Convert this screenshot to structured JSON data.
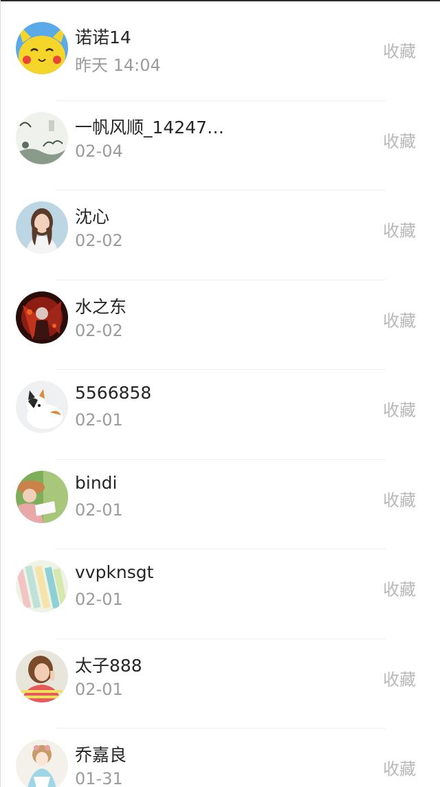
{
  "favorites_list": {
    "items": [
      {
        "name": "诺诺14",
        "time": "昨天 14:04",
        "action": "收藏",
        "avatar_icon": "pikachu-avatar-icon"
      },
      {
        "name": "一帆风顺_14247…",
        "time": "02-04",
        "action": "收藏",
        "avatar_icon": "ink-landscape-avatar-icon"
      },
      {
        "name": "沈心",
        "time": "02-02",
        "action": "收藏",
        "avatar_icon": "woman-portrait-avatar-icon"
      },
      {
        "name": "水之东",
        "time": "02-02",
        "action": "收藏",
        "avatar_icon": "red-dark-art-avatar-icon"
      },
      {
        "name": "5566858",
        "time": "02-01",
        "action": "收藏",
        "avatar_icon": "kitten-avatar-icon"
      },
      {
        "name": "bindi",
        "time": "02-01",
        "action": "收藏",
        "avatar_icon": "reading-girl-avatar-icon"
      },
      {
        "name": "vvpknsgt",
        "time": "02-01",
        "action": "收藏",
        "avatar_icon": "pastel-stationery-avatar-icon"
      },
      {
        "name": "太子888",
        "time": "02-01",
        "action": "收藏",
        "avatar_icon": "woman-striped-shirt-avatar-icon"
      },
      {
        "name": "乔嘉良",
        "time": "01-31",
        "action": "收藏",
        "avatar_icon": "anime-girl-avatar-icon"
      }
    ]
  }
}
